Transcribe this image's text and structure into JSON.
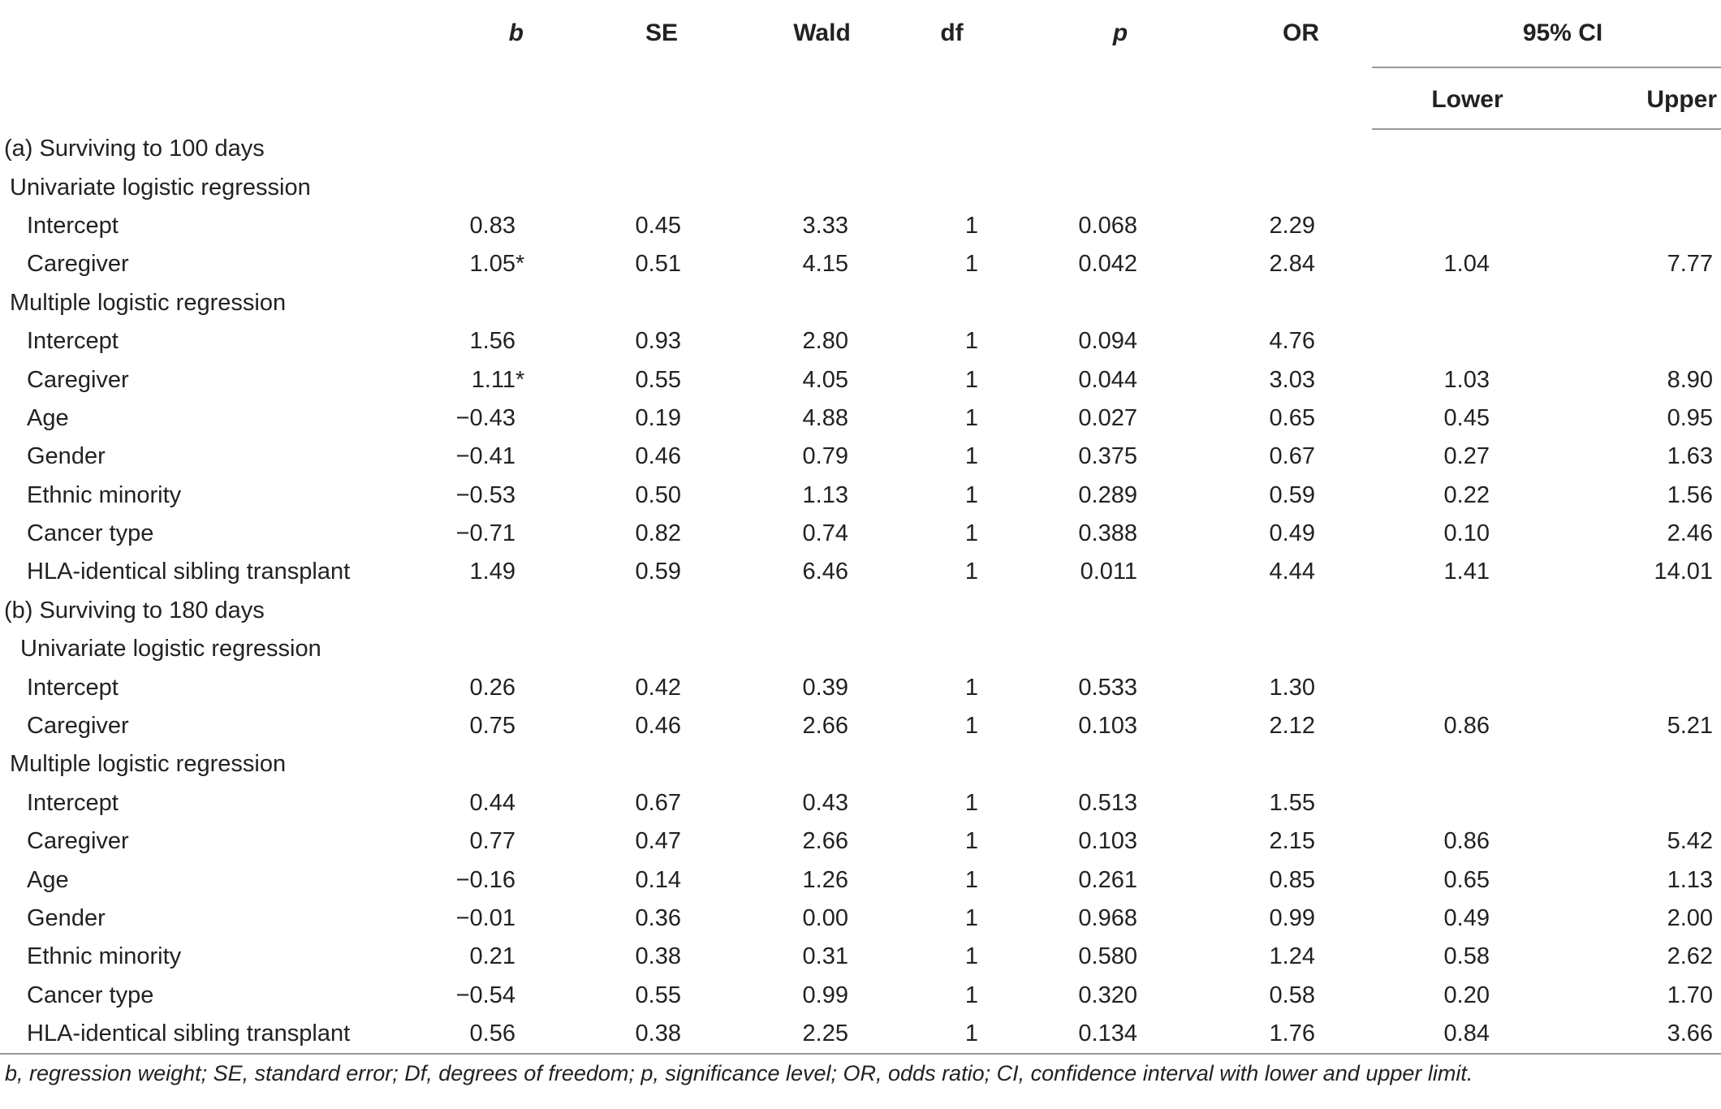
{
  "table": {
    "headers": {
      "b": "b",
      "se": "SE",
      "wald": "Wald",
      "df": "df",
      "p": "p",
      "or": "OR",
      "ci": "95% CI",
      "lower": "Lower",
      "upper": "Upper"
    },
    "rows": [
      {
        "type": "section",
        "level": 0,
        "label": "(a) Surviving to 100 days"
      },
      {
        "type": "section",
        "level": 1,
        "label": "Univariate logistic regression"
      },
      {
        "type": "data",
        "label": "Intercept",
        "b": "0.83",
        "star": "",
        "se": "0.45",
        "wald": "3.33",
        "df": "1",
        "p": "0.068",
        "or": "2.29",
        "lower": "",
        "upper": ""
      },
      {
        "type": "data",
        "label": "Caregiver",
        "b": "1.05",
        "star": "*",
        "se": "0.51",
        "wald": "4.15",
        "df": "1",
        "p": "0.042",
        "or": "2.84",
        "lower": "1.04",
        "upper": "7.77"
      },
      {
        "type": "section",
        "level": 1,
        "label": "Multiple logistic regression"
      },
      {
        "type": "data",
        "label": "Intercept",
        "b": "1.56",
        "star": "",
        "se": "0.93",
        "wald": "2.80",
        "df": "1",
        "p": "0.094",
        "or": "4.76",
        "lower": "",
        "upper": ""
      },
      {
        "type": "data",
        "label": "Caregiver",
        "b": "1.11",
        "star": "*",
        "se": "0.55",
        "wald": "4.05",
        "df": "1",
        "p": "0.044",
        "or": "3.03",
        "lower": "1.03",
        "upper": "8.90"
      },
      {
        "type": "data",
        "label": "Age",
        "b": "−0.43",
        "star": "",
        "se": "0.19",
        "wald": "4.88",
        "df": "1",
        "p": "0.027",
        "or": "0.65",
        "lower": "0.45",
        "upper": "0.95"
      },
      {
        "type": "data",
        "label": "Gender",
        "b": "−0.41",
        "star": "",
        "se": "0.46",
        "wald": "0.79",
        "df": "1",
        "p": "0.375",
        "or": "0.67",
        "lower": "0.27",
        "upper": "1.63"
      },
      {
        "type": "data",
        "label": "Ethnic minority",
        "b": "−0.53",
        "star": "",
        "se": "0.50",
        "wald": "1.13",
        "df": "1",
        "p": "0.289",
        "or": "0.59",
        "lower": "0.22",
        "upper": "1.56"
      },
      {
        "type": "data",
        "label": "Cancer type",
        "b": "−0.71",
        "star": "",
        "se": "0.82",
        "wald": "0.74",
        "df": "1",
        "p": "0.388",
        "or": "0.49",
        "lower": "0.10",
        "upper": "2.46"
      },
      {
        "type": "data",
        "label": "HLA-identical sibling transplant",
        "b": "1.49",
        "star": "",
        "se": "0.59",
        "wald": "6.46",
        "df": "1",
        "p": "0.011",
        "or": "4.44",
        "lower": "1.41",
        "upper": "14.01"
      },
      {
        "type": "section",
        "level": 0,
        "label": "(b) Surviving to 180 days"
      },
      {
        "type": "section",
        "level": 2,
        "label": "Univariate logistic regression"
      },
      {
        "type": "data",
        "label": "Intercept",
        "b": "0.26",
        "star": "",
        "se": "0.42",
        "wald": "0.39",
        "df": "1",
        "p": "0.533",
        "or": "1.30",
        "lower": "",
        "upper": ""
      },
      {
        "type": "data",
        "label": "Caregiver",
        "b": "0.75",
        "star": "",
        "se": "0.46",
        "wald": "2.66",
        "df": "1",
        "p": "0.103",
        "or": "2.12",
        "lower": "0.86",
        "upper": "5.21"
      },
      {
        "type": "section",
        "level": 1,
        "label": "Multiple logistic regression"
      },
      {
        "type": "data",
        "label": "Intercept",
        "b": "0.44",
        "star": "",
        "se": "0.67",
        "wald": "0.43",
        "df": "1",
        "p": "0.513",
        "or": "1.55",
        "lower": "",
        "upper": ""
      },
      {
        "type": "data",
        "label": "Caregiver",
        "b": "0.77",
        "star": "",
        "se": "0.47",
        "wald": "2.66",
        "df": "1",
        "p": "0.103",
        "or": "2.15",
        "lower": "0.86",
        "upper": "5.42"
      },
      {
        "type": "data",
        "label": "Age",
        "b": "−0.16",
        "star": "",
        "se": "0.14",
        "wald": "1.26",
        "df": "1",
        "p": "0.261",
        "or": "0.85",
        "lower": "0.65",
        "upper": "1.13"
      },
      {
        "type": "data",
        "label": "Gender",
        "b": "−0.01",
        "star": "",
        "se": "0.36",
        "wald": "0.00",
        "df": "1",
        "p": "0.968",
        "or": "0.99",
        "lower": "0.49",
        "upper": "2.00"
      },
      {
        "type": "data",
        "label": "Ethnic minority",
        "b": "0.21",
        "star": "",
        "se": "0.38",
        "wald": "0.31",
        "df": "1",
        "p": "0.580",
        "or": "1.24",
        "lower": "0.58",
        "upper": "2.62"
      },
      {
        "type": "data",
        "label": "Cancer type",
        "b": "−0.54",
        "star": "",
        "se": "0.55",
        "wald": "0.99",
        "df": "1",
        "p": "0.320",
        "or": "0.58",
        "lower": "0.20",
        "upper": "1.70"
      },
      {
        "type": "data",
        "label": "HLA-identical sibling transplant",
        "b": "0.56",
        "star": "",
        "se": "0.38",
        "wald": "2.25",
        "df": "1",
        "p": "0.134",
        "or": "1.76",
        "lower": "0.84",
        "upper": "3.66"
      }
    ]
  },
  "footnote": "b, regression weight; SE, standard error; Df, degrees of freedom; p, significance level; OR, odds ratio; CI, confidence interval with lower and upper limit."
}
